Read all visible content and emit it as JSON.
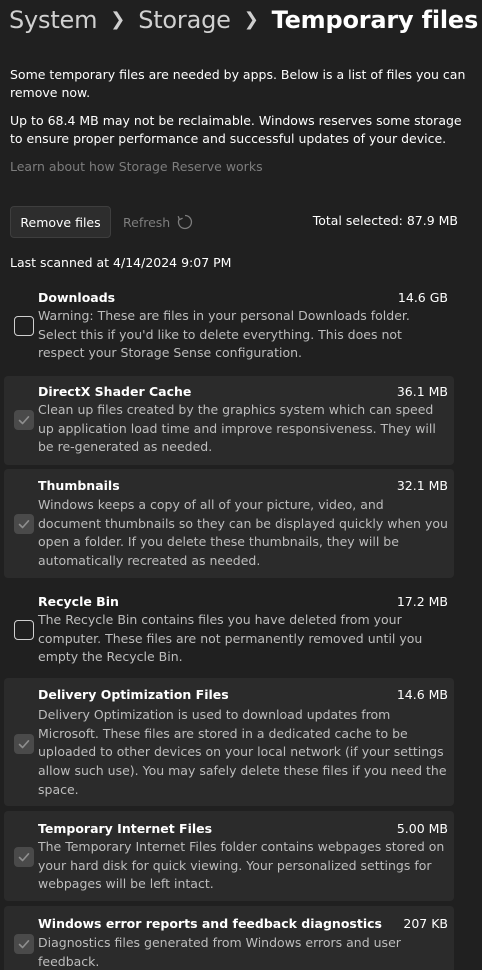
{
  "breadcrumb": {
    "items": [
      "System",
      "Storage",
      "Temporary files"
    ]
  },
  "intro": {
    "line1": "Some temporary files are needed by apps. Below is a list of files you can remove now.",
    "line2": "Up to 68.4 MB may not be reclaimable. Windows reserves some storage to ensure proper performance and successful updates of your device.",
    "learn_link": "Learn about how Storage Reserve works"
  },
  "actions": {
    "remove_label": "Remove files",
    "refresh_label": "Refresh",
    "total_selected": "Total selected: 87.9 MB"
  },
  "last_scanned": "Last scanned at 4/14/2024 9:07 PM",
  "items": [
    {
      "name": "Downloads",
      "size": "14.6 GB",
      "checked": false,
      "description": "Warning: These are files in your personal Downloads folder. Select this if you'd like to delete everything. This does not respect your Storage Sense configuration."
    },
    {
      "name": "DirectX Shader Cache",
      "size": "36.1 MB",
      "checked": true,
      "description": "Clean up files created by the graphics system which can speed up application load time and improve responsiveness. They will be re-generated as needed."
    },
    {
      "name": "Thumbnails",
      "size": "32.1 MB",
      "checked": true,
      "description": "Windows keeps a copy of all of your picture, video, and document thumbnails so they can be displayed quickly when you open a folder. If you delete these thumbnails, they will be automatically recreated as needed."
    },
    {
      "name": "Recycle Bin",
      "size": "17.2 MB",
      "checked": false,
      "description": "The Recycle Bin contains files you have deleted from your computer. These files are not permanently removed until you empty the Recycle Bin."
    },
    {
      "name": "Delivery Optimization Files",
      "size": "14.6 MB",
      "checked": true,
      "description": "Delivery Optimization is used to download updates from Microsoft. These files are stored in a dedicated cache to be uploaded to other devices on your local network (if your settings allow such use). You may safely delete these files if you need the space."
    },
    {
      "name": "Temporary Internet Files",
      "size": "5.00 MB",
      "checked": true,
      "description": "The Temporary Internet Files folder contains webpages stored on your hard disk for quick viewing. Your personalized settings for webpages will be left intact."
    },
    {
      "name": "Windows error reports and feedback diagnostics",
      "size": "207 KB",
      "checked": true,
      "description": "Diagnostics files generated from Windows errors and user feedback."
    }
  ]
}
